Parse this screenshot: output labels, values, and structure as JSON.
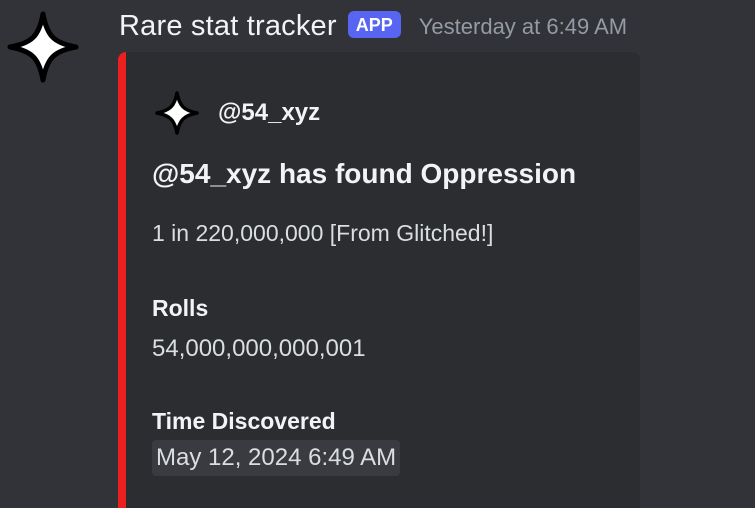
{
  "message": {
    "author": "Rare stat tracker",
    "badge": "APP",
    "timestamp": "Yesterday at 6:49 AM",
    "avatar_icon": "sparkle-star-icon"
  },
  "embed": {
    "accent_color": "#ed2020",
    "author_icon": "sparkle-star-icon",
    "author_name": "@54_xyz",
    "title": "@54_xyz has found Oppression",
    "description": "1 in 220,000,000 [From Glitched!]",
    "fields": [
      {
        "name": "Rolls",
        "value": "54,000,000,000,001"
      },
      {
        "name": "Time Discovered",
        "value": "May 12, 2024 6:49 AM"
      }
    ]
  }
}
